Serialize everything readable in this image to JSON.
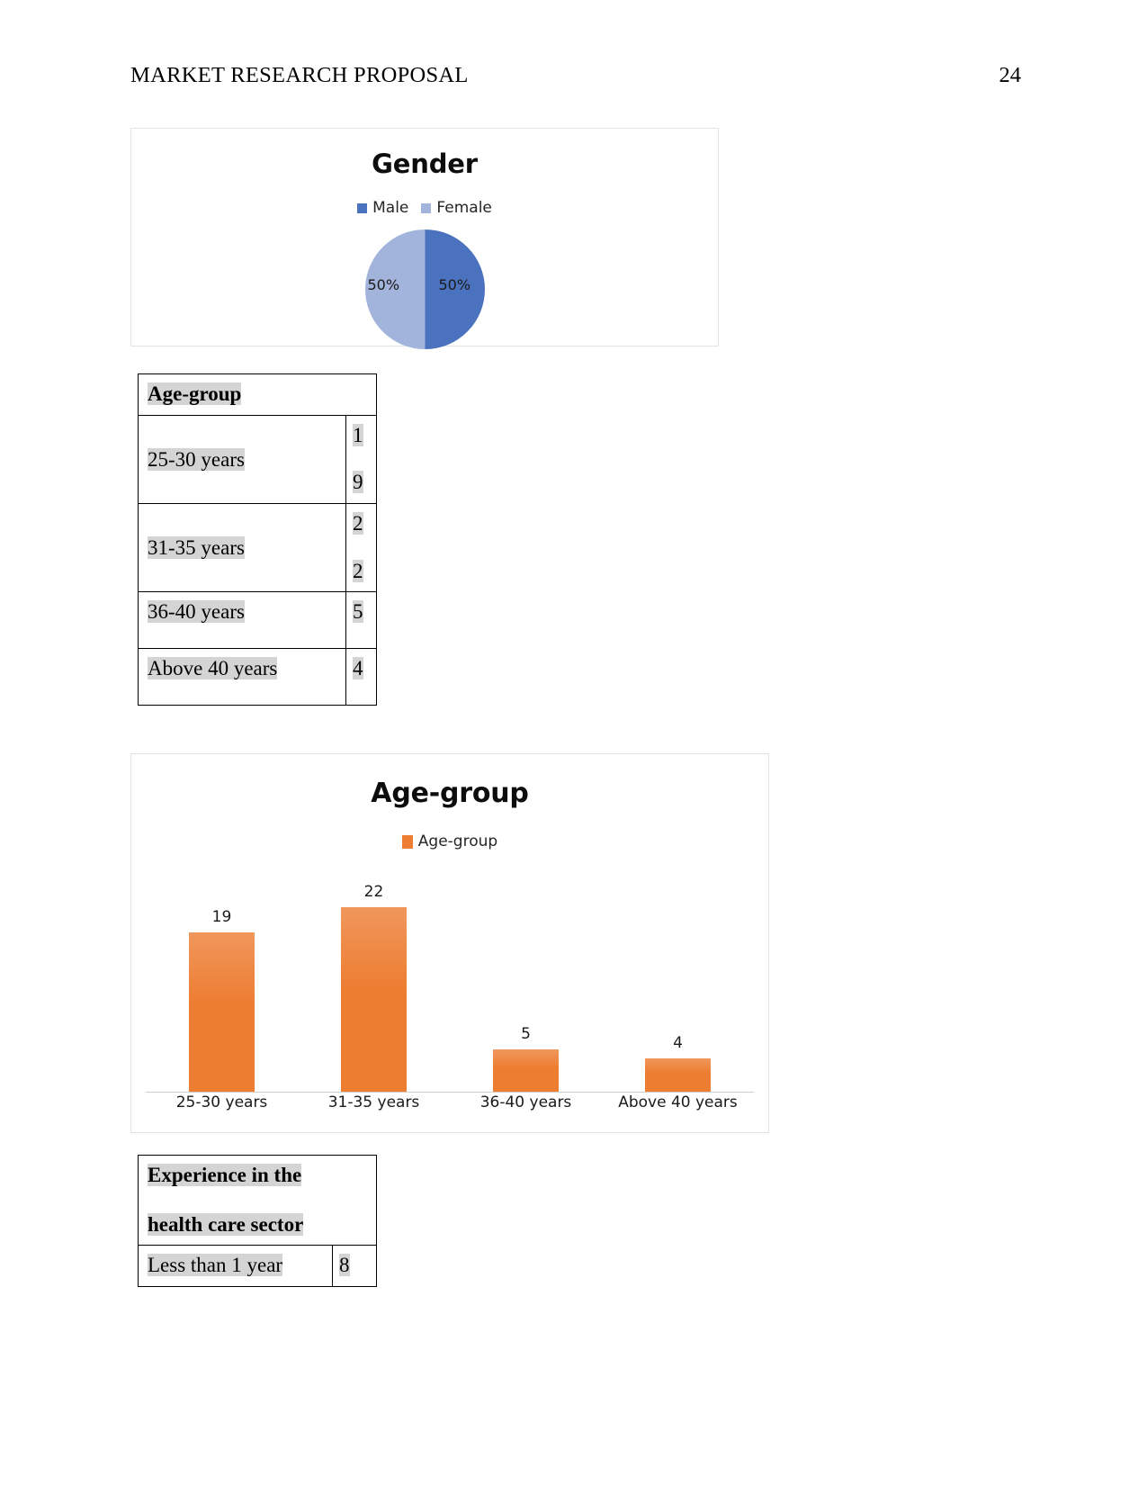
{
  "header": {
    "running_title": "MARKET RESEARCH PROPOSAL",
    "page_number": "24"
  },
  "pie_chart": {
    "title": "Gender",
    "legend": [
      {
        "label": "Male",
        "color": "#4A72BE"
      },
      {
        "label": "Female",
        "color": "#A3B4DC"
      }
    ],
    "labels": {
      "left": "50%",
      "right": "50%"
    }
  },
  "age_group_table": {
    "header": "Age-group",
    "rows": [
      {
        "label": "25-30 years",
        "value_line1": "1",
        "value_line2": "9",
        "wrapped": true
      },
      {
        "label": "31-35 years",
        "value_line1": "2",
        "value_line2": "2",
        "wrapped": true
      },
      {
        "label": "36-40 years",
        "value_line1": "5",
        "value_line2": "",
        "wrapped": false
      },
      {
        "label": "Above 40 years",
        "value_line1": "4",
        "value_line2": "",
        "wrapped": false
      }
    ]
  },
  "bar_chart": {
    "title": "Age-group",
    "legend": [
      {
        "label": "Age-group",
        "color": "#ED7D31"
      }
    ]
  },
  "experience_table": {
    "header_line1": "Experience in the",
    "header_line2": "health care sector",
    "rows": [
      {
        "label": "Less than 1 year",
        "value": "8"
      }
    ]
  },
  "chart_data": [
    {
      "type": "pie",
      "title": "Gender",
      "categories": [
        "Male",
        "Female"
      ],
      "values": [
        50,
        50
      ],
      "value_labels": [
        "50%",
        "50%"
      ],
      "colors": [
        "#4A72BE",
        "#A3B4DC"
      ],
      "legend_position": "top",
      "grid": false
    },
    {
      "type": "bar",
      "title": "Age-group",
      "categories": [
        "25-30 years",
        "31-35 years",
        "36-40 years",
        "Above 40 years"
      ],
      "values": [
        19,
        22,
        5,
        4
      ],
      "series": [
        {
          "name": "Age-group",
          "values": [
            19,
            22,
            5,
            4
          ],
          "color": "#ED7D31"
        }
      ],
      "xlabel": "",
      "ylabel": "",
      "ylim": [
        0,
        24
      ],
      "legend_position": "top",
      "grid": false,
      "data_labels": true
    }
  ]
}
